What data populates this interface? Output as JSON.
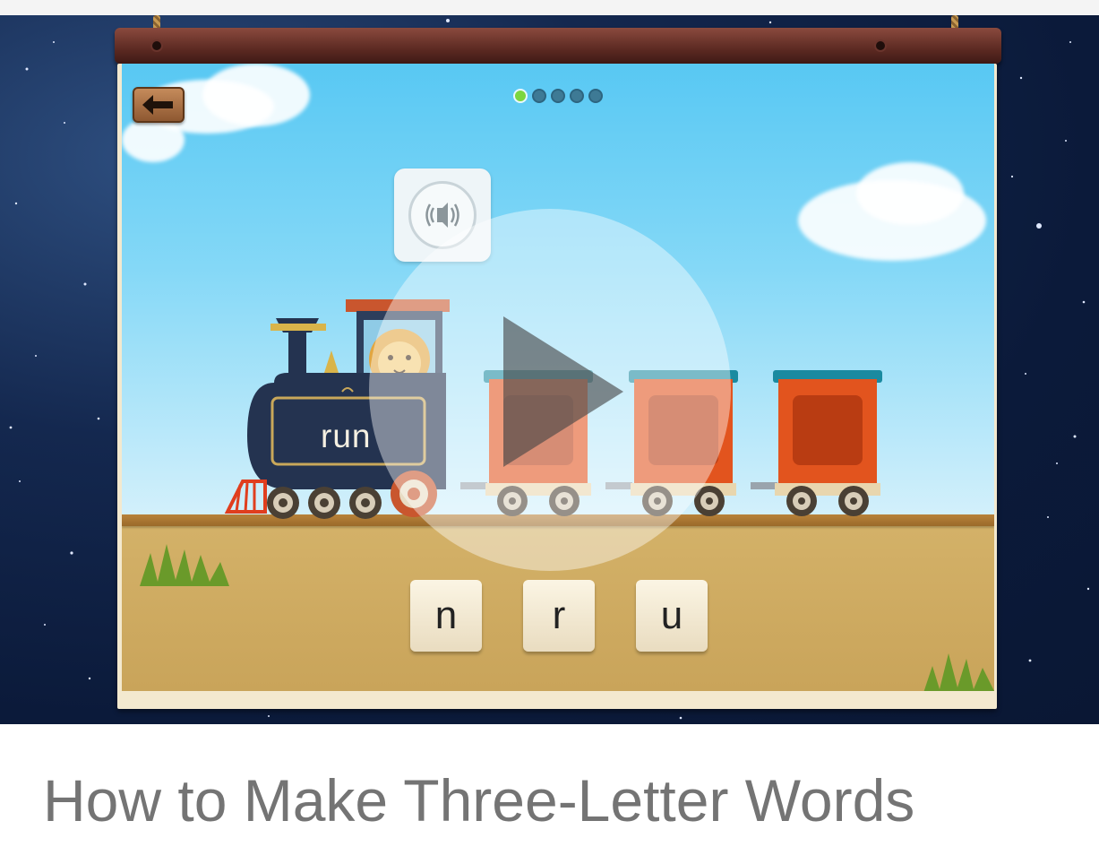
{
  "video": {
    "title": "How to Make Three-Letter Words"
  },
  "game": {
    "word": "run",
    "letter_tiles": [
      "n",
      "r",
      "u"
    ],
    "pager": {
      "total": 5,
      "current": 1
    },
    "colors": {
      "sky": "#58c8f3",
      "ground": "#d4b269",
      "engine": "#243350",
      "wagon": "#e2541e",
      "active_dot": "#7cd63f"
    }
  },
  "icons": {
    "back": "back-arrow-icon",
    "sound": "speaker-icon",
    "play": "play-icon"
  }
}
